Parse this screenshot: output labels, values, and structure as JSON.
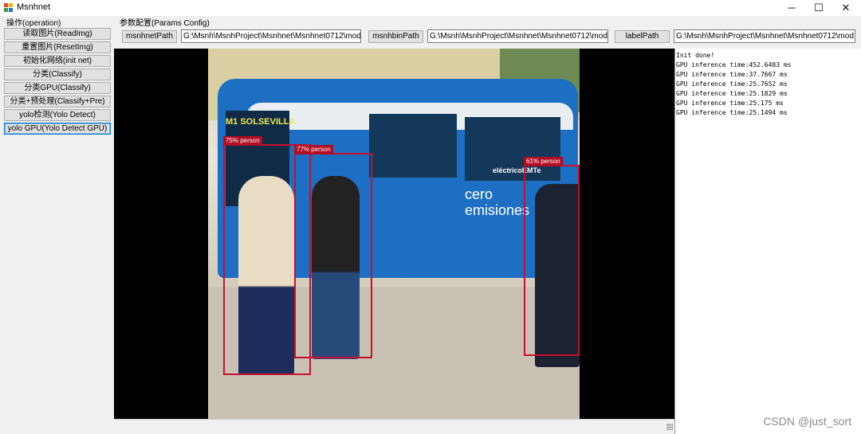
{
  "window": {
    "title": "Msnhnet",
    "minimize": "─",
    "maximize": "☐",
    "close": "✕"
  },
  "operation": {
    "label": "操作(operation)",
    "buttons": [
      "读取图片(ReadImg)",
      "重置图片(ResetImg)",
      "初始化网络(init net)",
      "分类(Classify)",
      "分类GPU(Classify)",
      "分类+预处理(Classify+Pre)",
      "yolo检测(Yolo Detect)",
      "yolo GPU(Yolo Detect GPU)"
    ]
  },
  "params": {
    "label": "参数配置(Params Config)",
    "msnhnet_button": "msnhnetPath",
    "msnhnet_value": "G:\\Msnh\\MsnhProject\\Msnhnet\\Msnhnet0712\\mod",
    "msnhbin_button": "msnhbinPath",
    "msnhbin_value": "G:\\Msnh\\MsnhProject\\Msnhnet\\Msnhnet0712\\mod",
    "label_button": "labelPath",
    "label_value": "G:\\Msnh\\MsnhProject\\Msnhnet\\Msnhnet0712\\mod"
  },
  "detections": [
    {
      "label": "75% person"
    },
    {
      "label": "77% person"
    },
    {
      "label": "61% person"
    }
  ],
  "bus_text": {
    "route": "M1 SOLSEVILLA",
    "side1": "cero",
    "side2": "emisiones",
    "brand": "eléctricoEMTe"
  },
  "log": [
    "Init done!",
    "GPU inference time:452.6483 ms",
    "GPU inference time:37.7667 ms",
    "GPU inference time:25.7652 ms",
    "GPU inference time:25.1829 ms",
    "GPU inference time:25.175 ms",
    "GPU inference time:25.1494 ms"
  ],
  "watermark": "CSDN @just_sort",
  "colors": {
    "detection_box": "#c8102e",
    "bus_blue": "#1d6fc4"
  }
}
